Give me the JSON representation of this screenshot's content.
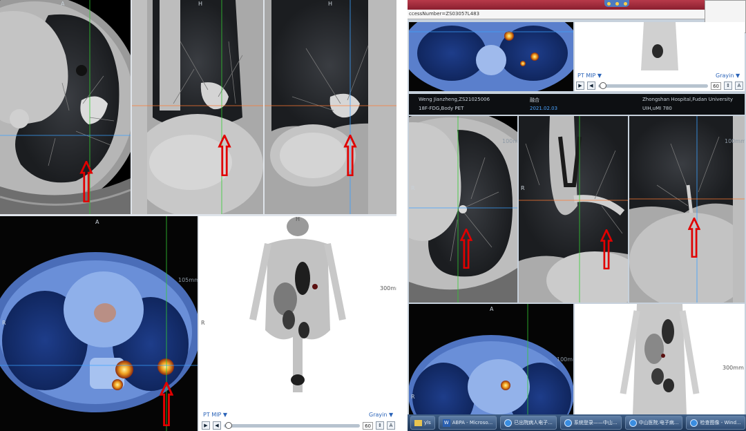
{
  "left_panel": {
    "ct_axial": {
      "orient_top": "A"
    },
    "ct_coronal": {
      "orient_top": "H"
    },
    "ct_sagittal": {
      "orient_top": "H"
    },
    "fusion_axial": {
      "orient_top": "A",
      "orient_left": "R",
      "scale_label": "105mm"
    },
    "mip": {
      "orient_top": "H",
      "orient_right": "R",
      "scale_label": "300mm",
      "name_label": "PT MIP ▼",
      "color_label": "Grayin ▼",
      "frame_value": "60"
    }
  },
  "right_panel": {
    "url_text": "ccessNumber=ZS03057L483",
    "upper_mip": {
      "name_label": "PT MIP ▼",
      "color_label": "Grayin ▼",
      "frame_value": "60"
    },
    "info_bar": {
      "patient": "Weng Jianzheng,ZS21025006",
      "fusion": "融合",
      "hospital": "Zhongshan Hospital,Fudan University",
      "series": "18F-FDG,Body PET",
      "date": "2021.02.03",
      "scanner": "UIH,uMI 780"
    },
    "ct_axial": {
      "orient_left": "R",
      "scale_label": "100mm"
    },
    "ct_coronal": {
      "orient_left": "R"
    },
    "ct_sagittal": {
      "scale_label": "100mm"
    },
    "fusion_axial": {
      "orient_top": "A",
      "orient_left": "R",
      "scale_label": "100mm"
    },
    "mip": {
      "scale_label": "300mm"
    }
  },
  "taskbar": {
    "items": [
      {
        "icon": "folder",
        "label": "yls"
      },
      {
        "icon": "word",
        "label": "ABPA - Microso..."
      },
      {
        "icon": "ie",
        "label": "已出院病人电子..."
      },
      {
        "icon": "ie",
        "label": "系统登录——中山..."
      },
      {
        "icon": "ie",
        "label": "中山医院.电子病..."
      },
      {
        "icon": "ie",
        "label": "检查图像 - Wind..."
      }
    ]
  },
  "colors": {
    "arrow": "#e00000",
    "crosshair_green": "#33cc33",
    "crosshair_blue": "#3aa0ff",
    "crosshair_orange": "#ff7a33"
  }
}
